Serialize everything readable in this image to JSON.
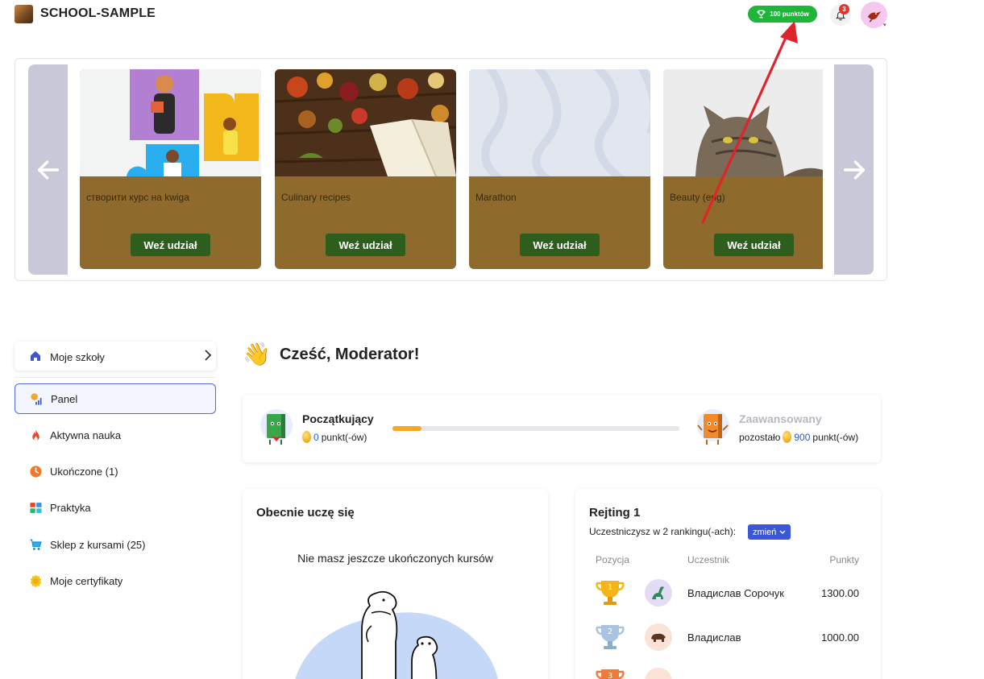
{
  "header": {
    "school_name": "SCHOOL-SAMPLE",
    "points_badge": "100 punktów",
    "notification_count": "3"
  },
  "carousel": {
    "cards": [
      {
        "title": "створити курс на kwiga",
        "button": "Weź udział"
      },
      {
        "title": "Culinary recipes",
        "button": "Weź udział"
      },
      {
        "title": "Marathon",
        "button": "Weź udział"
      },
      {
        "title": "Beauty (eng)",
        "button": "Weź udział"
      }
    ]
  },
  "sidebar": {
    "school_switch": "Moje szkoły",
    "items": [
      {
        "label": "Panel",
        "active": true
      },
      {
        "label": "Aktywna nauka",
        "active": false
      },
      {
        "label": "Ukończone (1)",
        "active": false
      },
      {
        "label": "Praktyka",
        "active": false
      },
      {
        "label": "Sklep z kursami (25)",
        "active": false
      },
      {
        "label": "Moje certyfikaty",
        "active": false
      }
    ]
  },
  "greeting": "Cześć, Moderator!",
  "progress": {
    "current_level": "Początkujący",
    "current_points": "0",
    "points_suffix": "punkt(-ów)",
    "next_level": "Zaawansowany",
    "remaining_label": "pozostało",
    "remaining_points": "900",
    "progress_fraction": 0.1
  },
  "learning": {
    "title": "Obecnie uczę się",
    "empty_text": "Nie masz jeszcze ukończonych kursów"
  },
  "ranking": {
    "title": "Rejting 1",
    "participation": "Uczestniczysz w 2 rankingu(-ach):",
    "change_button": "zmień",
    "columns": {
      "position": "Pozycja",
      "participant": "Uczestnik",
      "points": "Punkty"
    },
    "rows": [
      {
        "position": "1",
        "name": "Владислав Сорочук",
        "points": "1300.00"
      },
      {
        "position": "2",
        "name": "Владислав",
        "points": "1000.00"
      },
      {
        "position": "3",
        "name": "",
        "points": ""
      }
    ]
  },
  "colors": {
    "accent_blue": "#3b57d6",
    "points_green": "#1fb43a",
    "card_brown": "#8e6a2c",
    "card_button": "#2e5e1e",
    "annotation_red": "#e0242c"
  }
}
